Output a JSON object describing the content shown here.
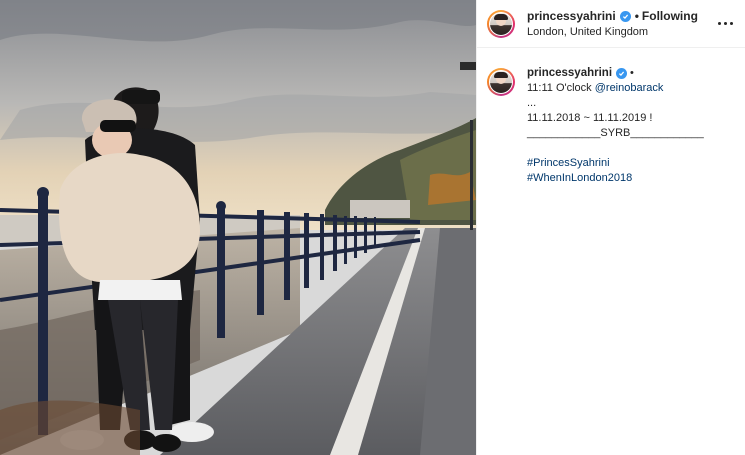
{
  "post": {
    "photo_alt": "Couple posing on a seaside promenade",
    "header": {
      "username": "princessyahrini",
      "separator": "•",
      "follow_status": "Following",
      "location": "London, United Kingdom",
      "more_icon": "more-horizontal-icon"
    },
    "caption": {
      "username": "princessyahrini",
      "trail": "•",
      "line1_prefix": "11:11 O'clock ",
      "line1_mention": "@reinobarack",
      "line2": "...",
      "line3": "11.11.2018 ~ 11.11.2019 !",
      "line4": "____________SYRB____________",
      "hashtags": [
        "#PrincesSyahrini",
        "#WhenInLondon2018"
      ]
    }
  },
  "colors": {
    "link": "#00376b",
    "verified": "#3897f0",
    "text": "#262626"
  }
}
